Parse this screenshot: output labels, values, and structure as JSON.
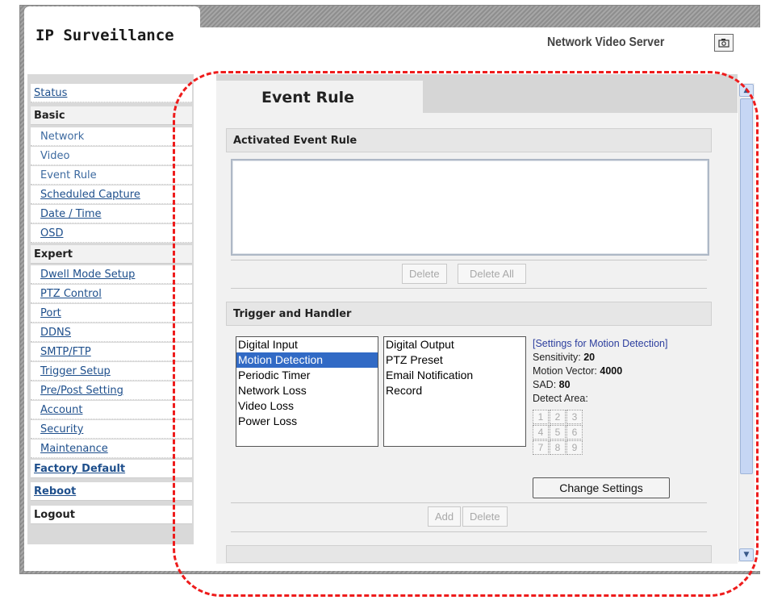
{
  "app_title": "IP Surveillance",
  "product_name": "Network Video Server",
  "snapshot_icon": "camera-icon",
  "sidebar": {
    "status": "Status",
    "basic_header": "Basic",
    "basic_items": [
      "Network",
      "Video",
      "Event Rule",
      "Scheduled Capture",
      "Date / Time",
      "OSD"
    ],
    "expert_header": "Expert",
    "expert_items": [
      "Dwell Mode Setup",
      "PTZ Control",
      "Port",
      "DDNS",
      "SMTP/FTP",
      "Trigger Setup",
      "Pre/Post Setting",
      "Account",
      "Security",
      "Maintenance"
    ],
    "factory_default": "Factory Default",
    "reboot": "Reboot",
    "logout": "Logout"
  },
  "page_title": "Event Rule",
  "activated_section": {
    "title": "Activated Event Rule",
    "delete_label": "Delete",
    "delete_all_label": "Delete All"
  },
  "trigger_section": {
    "title": "Trigger and Handler",
    "triggers": [
      "Digital Input",
      "Motion Detection",
      "Periodic Timer",
      "Network Loss",
      "Video Loss",
      "Power Loss"
    ],
    "selected_trigger": "Motion Detection",
    "handlers": [
      "Digital Output",
      "PTZ Preset",
      "Email Notification",
      "Record"
    ],
    "settings": {
      "header": "[Settings for Motion Detection]",
      "sensitivity_label": "Sensitivity:",
      "sensitivity_value": "20",
      "motion_vector_label": "Motion Vector:",
      "motion_vector_value": "4000",
      "sad_label": "SAD:",
      "sad_value": "80",
      "detect_area_label": "Detect Area:",
      "areas": [
        "1",
        "2",
        "3",
        "4",
        "5",
        "6",
        "7",
        "8",
        "9"
      ]
    },
    "change_settings_label": "Change Settings",
    "add_label": "Add",
    "delete_label": "Delete"
  },
  "colors": {
    "highlight": "#ee1c1c",
    "link": "#1e4f8c",
    "selection": "#316ac5"
  }
}
